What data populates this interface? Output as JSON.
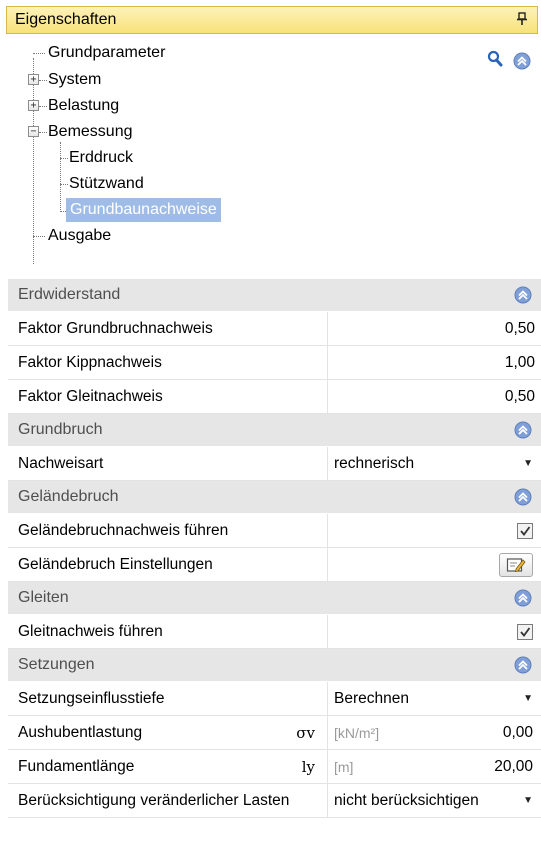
{
  "panel": {
    "title": "Eigenschaften"
  },
  "tree": {
    "grundparameter": "Grundparameter",
    "system": "System",
    "belastung": "Belastung",
    "bemessung": "Bemessung",
    "erddruck": "Erddruck",
    "stuetzwand": "Stützwand",
    "grundbaunachweise": "Grundbaunachweise",
    "ausgabe": "Ausgabe"
  },
  "sections": {
    "erdwiderstand": {
      "title": "Erdwiderstand",
      "rows": [
        {
          "label": "Faktor Grundbruchnachweis",
          "value": "0,50"
        },
        {
          "label": "Faktor Kippnachweis",
          "value": "1,00"
        },
        {
          "label": "Faktor Gleitnachweis",
          "value": "0,50"
        }
      ]
    },
    "grundbruch": {
      "title": "Grundbruch",
      "nachweisart_label": "Nachweisart",
      "nachweisart_value": "rechnerisch"
    },
    "gelaendebruch": {
      "title": "Geländebruch",
      "fuehren_label": "Geländebruchnachweis führen",
      "fuehren_checked": true,
      "einstellungen_label": "Geländebruch Einstellungen"
    },
    "gleiten": {
      "title": "Gleiten",
      "fuehren_label": "Gleitnachweis führen",
      "fuehren_checked": true
    },
    "setzungen": {
      "title": "Setzungen",
      "tiefe_label": "Setzungseinflusstiefe",
      "tiefe_value": "Berechnen",
      "aushub_label": "Aushubentlastung",
      "aushub_symbol": "σv",
      "aushub_unit": "[kN/m²]",
      "aushub_value": "0,00",
      "laenge_label": "Fundamentlänge",
      "laenge_symbol": "ly",
      "laenge_unit": "[m]",
      "laenge_value": "20,00",
      "lasten_label": "Berücksichtigung veränderlicher Lasten",
      "lasten_value": "nicht berücksichtigen"
    }
  },
  "colors": {
    "title_bg": "#f8e27a",
    "section_bg": "#e6e6e6",
    "selection": "#9fbce7",
    "collapse_icon": "#7f9fd6"
  }
}
